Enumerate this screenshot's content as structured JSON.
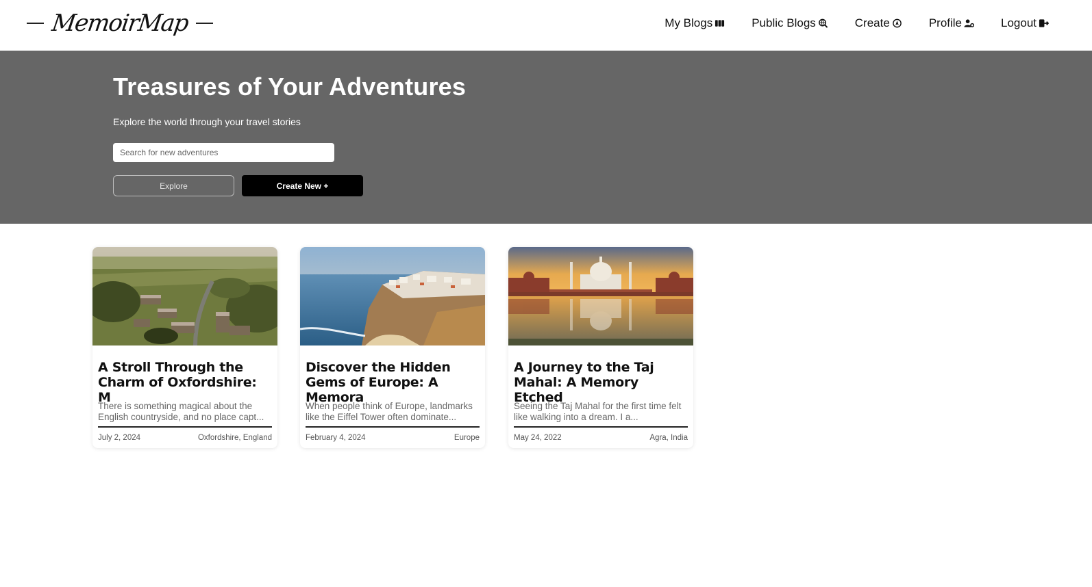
{
  "brand": {
    "name": "MemoirMap"
  },
  "nav": [
    {
      "label": "My Blogs",
      "icon": "book-icon"
    },
    {
      "label": "Public Blogs",
      "icon": "search-globe-icon"
    },
    {
      "label": "Create",
      "icon": "compass-icon"
    },
    {
      "label": "Profile",
      "icon": "user-gear-icon"
    },
    {
      "label": "Logout",
      "icon": "logout-icon"
    }
  ],
  "hero": {
    "title": "Treasures of Your Adventures",
    "subtitle": "Explore the world through your travel stories",
    "search_placeholder": "Search for new adventures",
    "explore_label": "Explore",
    "create_label": "Create New +"
  },
  "cards": [
    {
      "image": "aerial-village-photo",
      "title": "A Stroll Through the Charm of Oxfordshire: M",
      "excerpt": "There is something magical about the English countryside, and no place capt...",
      "date": "July 2, 2024",
      "location": "Oxfordshire, England"
    },
    {
      "image": "coastal-cliff-town-photo",
      "title": "Discover the Hidden Gems of Europe: A Memora",
      "excerpt": "When people think of Europe, landmarks like the Eiffel Tower often dominate...",
      "date": "February 4, 2024",
      "location": "Europe"
    },
    {
      "image": "taj-mahal-photo",
      "title": "A Journey to the Taj Mahal: A Memory Etched",
      "excerpt": "Seeing the Taj Mahal for the first time felt like walking into a dream. I a...",
      "date": "May 24, 2022",
      "location": "Agra, India"
    }
  ],
  "colors": {
    "hero_bg": "#666666",
    "primary_button": "#000000",
    "text": "#111111",
    "muted_text": "#666666"
  }
}
